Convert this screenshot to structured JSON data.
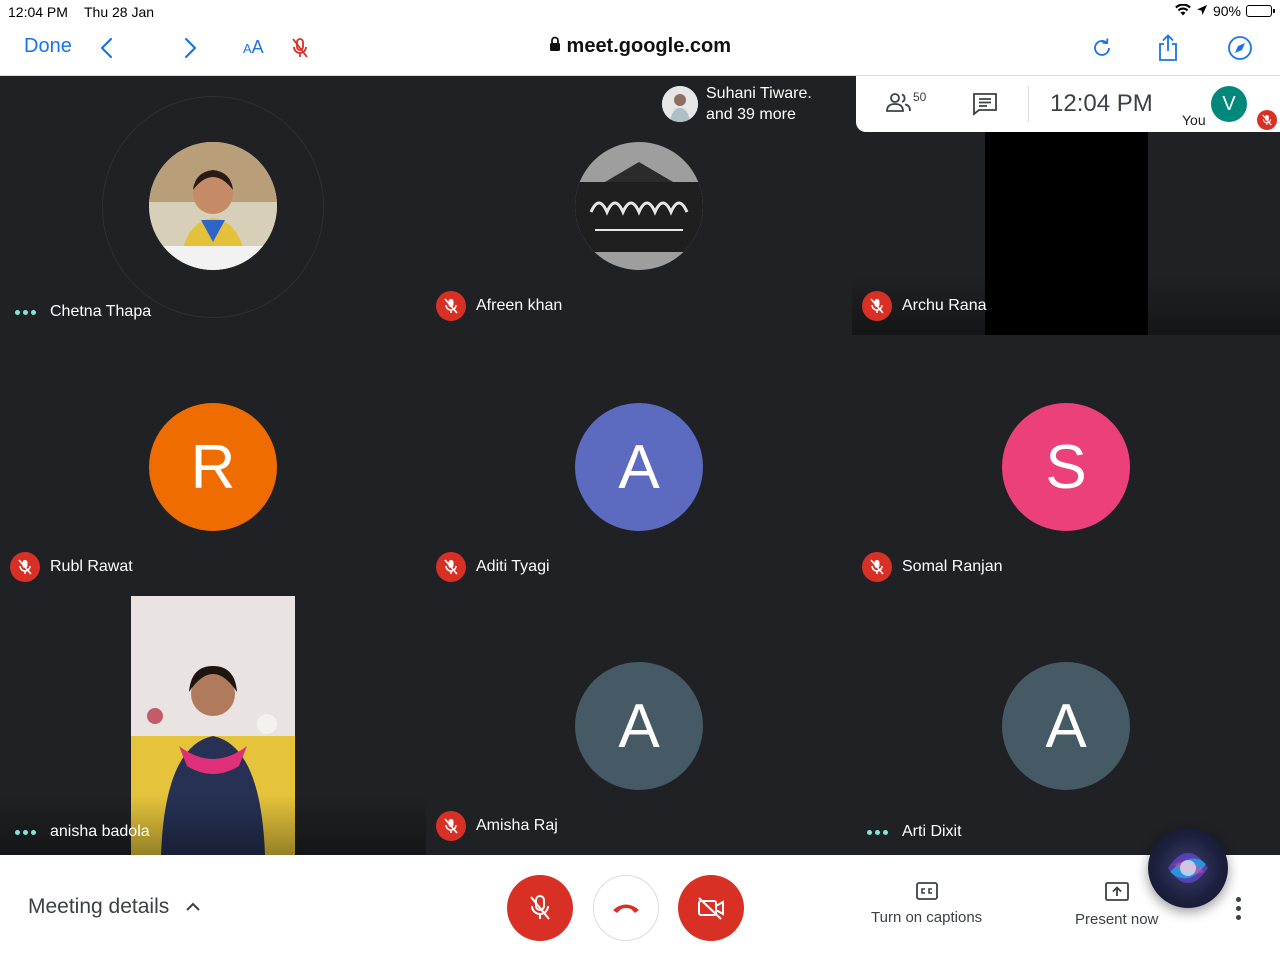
{
  "status_bar": {
    "time": "12:04 PM",
    "date": "Thu 28 Jan",
    "battery": "90%"
  },
  "safari": {
    "done_label": "Done",
    "url": "meet.google.com",
    "text_size_small": "A",
    "text_size_large": "A"
  },
  "top_overlay": {
    "presenter_name": "Suhani Tiware.",
    "presenter_more": "and 39 more",
    "participants_count": "50",
    "clock": "12:04  PM",
    "self_initial": "V",
    "self_label": "You"
  },
  "tiles": [
    {
      "name": "Chetna Thapa",
      "status": "speaking-dots",
      "kind": "photo-avatar"
    },
    {
      "name": "Afreen khan",
      "status": "muted",
      "kind": "photo-avatar"
    },
    {
      "name": "Archu Rana",
      "status": "muted",
      "kind": "video-black"
    },
    {
      "name": "Rubl Rawat",
      "status": "muted",
      "kind": "letter",
      "initial": "R",
      "color": "#ef6c00"
    },
    {
      "name": "Aditi Tyagi",
      "status": "muted",
      "kind": "letter",
      "initial": "A",
      "color": "#5c6bc0"
    },
    {
      "name": "Somal Ranjan",
      "status": "muted",
      "kind": "letter",
      "initial": "S",
      "color": "#ec407a"
    },
    {
      "name": "anisha badola",
      "status": "speaking-dots",
      "kind": "video"
    },
    {
      "name": "Amisha Raj",
      "status": "muted",
      "kind": "letter",
      "initial": "A",
      "color": "#455a64"
    },
    {
      "name": "Arti Dixit",
      "status": "speaking-dots",
      "kind": "letter",
      "initial": "A",
      "color": "#455a64"
    }
  ],
  "bottom_bar": {
    "meeting_details": "Meeting details",
    "captions_label": "Turn on captions",
    "present_label": "Present now"
  },
  "colors": {
    "mute_red": "#d93025",
    "safari_blue": "#1a73e8",
    "bg_dark": "#202124"
  }
}
